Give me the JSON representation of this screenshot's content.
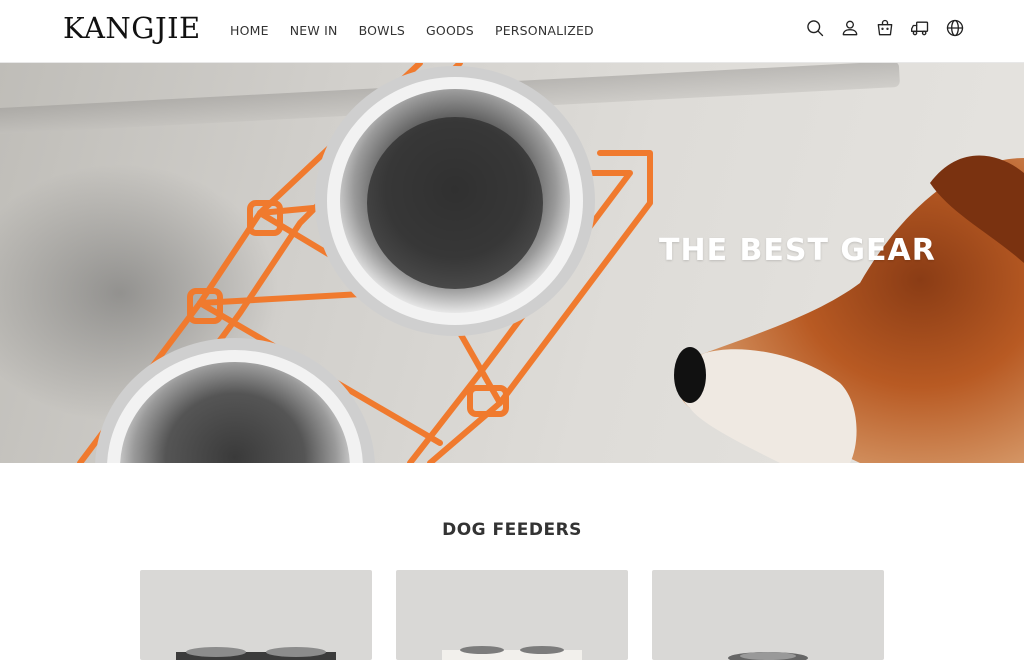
{
  "header": {
    "logo": "KANGJIE",
    "nav": [
      {
        "label": "HOME"
      },
      {
        "label": "NEW IN"
      },
      {
        "label": "BOWLS"
      },
      {
        "label": "GOODS"
      },
      {
        "label": "PERSONALIZED"
      }
    ],
    "icons": [
      "search-icon",
      "account-icon",
      "cart-icon",
      "shipping-icon",
      "globe-icon"
    ]
  },
  "hero": {
    "title": "THE BEST GEAR",
    "colors": {
      "rack": "#f07a2e",
      "floor": "#d4d2ce",
      "dog_fur": "#b85a23"
    }
  },
  "section": {
    "title": "DOG FEEDERS",
    "cards": [
      {
        "name": "feeder-1"
      },
      {
        "name": "feeder-2"
      },
      {
        "name": "feeder-3"
      }
    ]
  }
}
